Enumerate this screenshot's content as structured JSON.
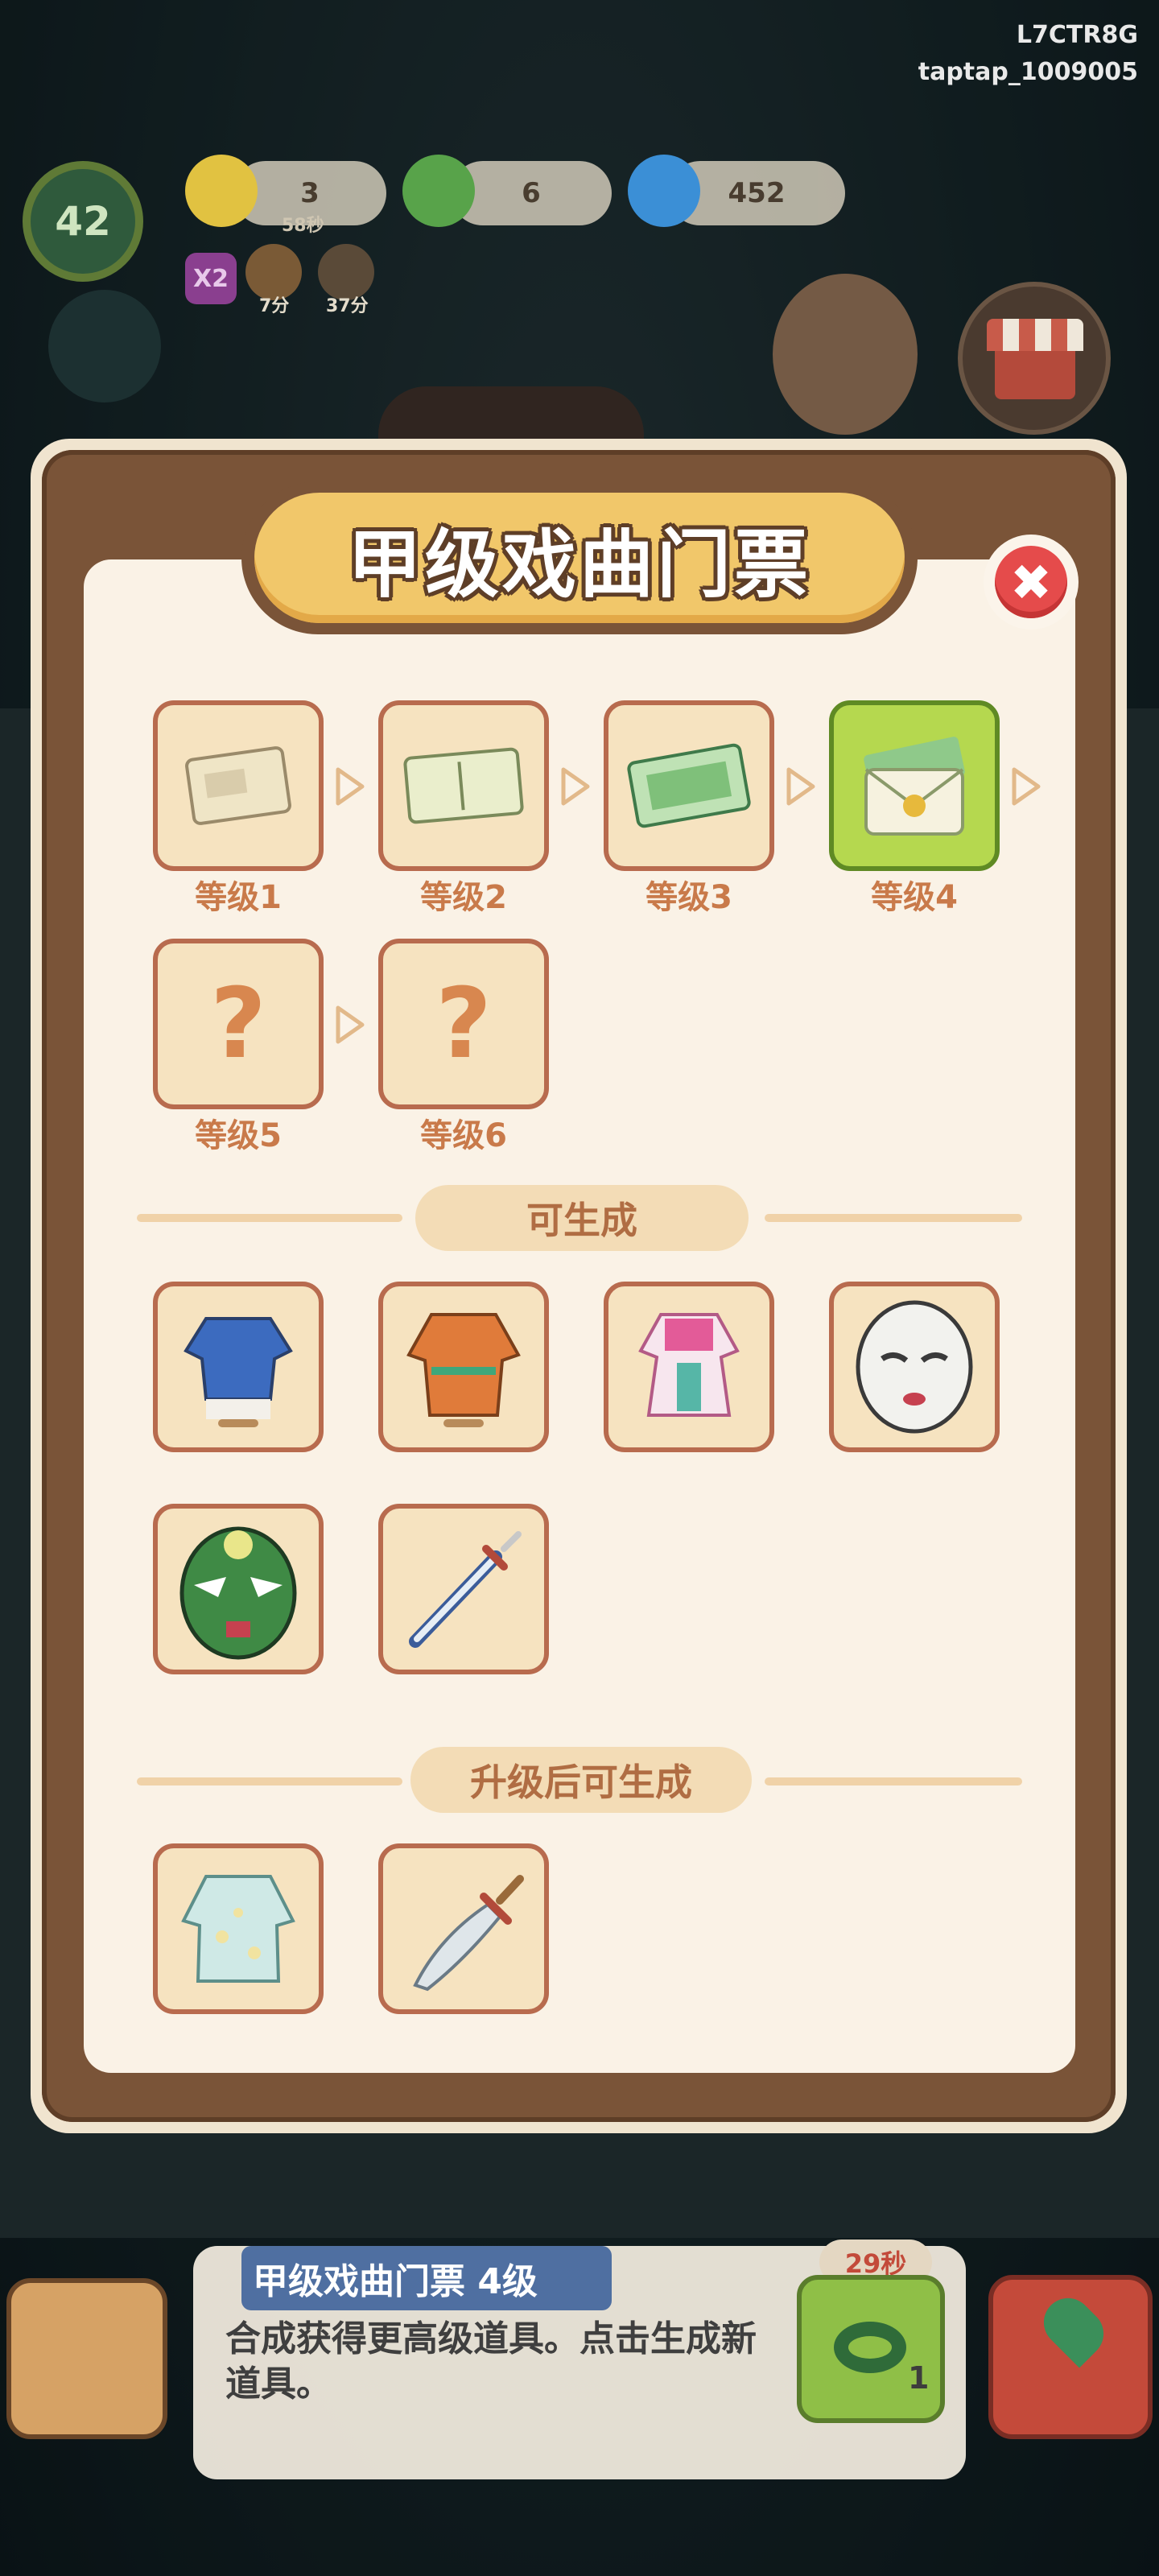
{
  "status": {
    "id_line1": "L7CTR8G",
    "id_line2": "taptap_1009005"
  },
  "hud": {
    "player_level": "42",
    "resources": [
      {
        "value": "3",
        "sub": "58秒",
        "icon": "energy-icon"
      },
      {
        "value": "6",
        "icon": "jade-coin-icon"
      },
      {
        "value": "452",
        "icon": "blue-flame-icon"
      }
    ],
    "boost_label": "X2",
    "timers": [
      "7分",
      "37分"
    ]
  },
  "modal": {
    "title": "甲级戏曲门票",
    "close_label": "✖",
    "levels": [
      {
        "label": "等级1",
        "icon": "ticket-level1-icon",
        "known": true
      },
      {
        "label": "等级2",
        "icon": "ticket-level2-icon",
        "known": true
      },
      {
        "label": "等级3",
        "icon": "ticket-level3-icon",
        "known": true
      },
      {
        "label": "等级4",
        "icon": "ticket-level4-icon",
        "known": true,
        "current": true
      },
      {
        "label": "等级5",
        "icon": "unknown-icon",
        "known": false,
        "glyph": "?"
      },
      {
        "label": "等级6",
        "icon": "unknown-icon",
        "known": false,
        "glyph": "?"
      }
    ],
    "section_generate": "可生成",
    "generate_items": [
      "blue-robe-icon",
      "orange-robe-icon",
      "pink-dress-icon",
      "white-mask-icon",
      "green-mask-icon",
      "sword-icon"
    ],
    "section_upgrade": "升级后可生成",
    "upgrade_items": [
      "floral-robe-icon",
      "broadsword-icon"
    ]
  },
  "bottom": {
    "item_title": "甲级戏曲门票  4级",
    "description": "合成获得更高级道具。点击生成新道具。",
    "timer": "29秒",
    "coin_count": "1"
  },
  "colors": {
    "accent": "#f1c76a",
    "frame": "#7a5438",
    "active_tile": "#b5d84f",
    "label": "#c97a4a",
    "close": "#e54b4b"
  }
}
